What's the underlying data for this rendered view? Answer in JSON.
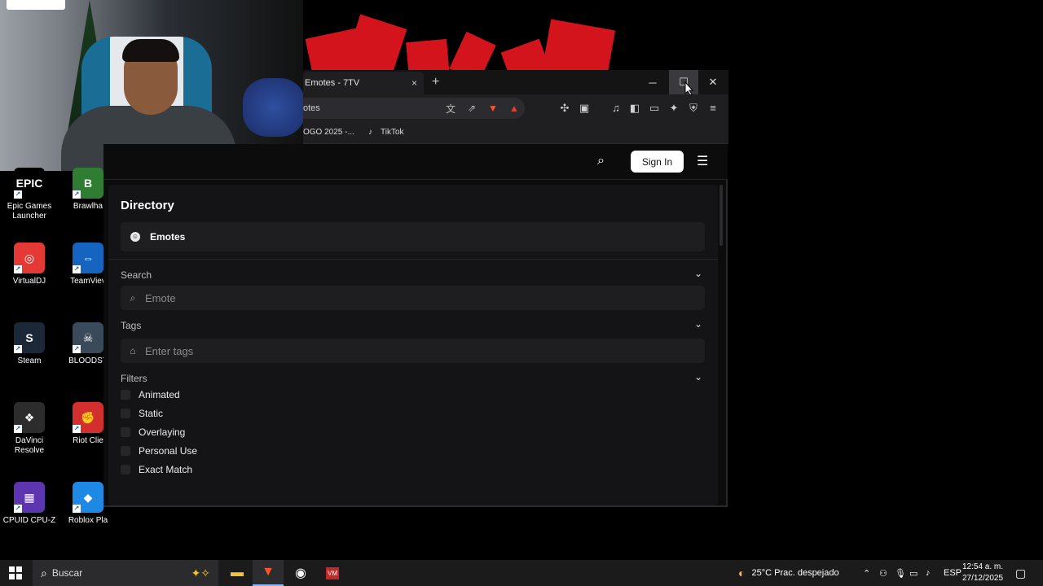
{
  "desktop_icons": [
    {
      "id": "epic",
      "label": "Epic Games Launcher",
      "glyph": "EPIC",
      "color": "#000000"
    },
    {
      "id": "brawl",
      "label": "Brawlha",
      "glyph": "B",
      "color": "#2e7d32"
    },
    {
      "id": "virtualdj",
      "label": "VirtualDJ",
      "glyph": "◎",
      "color": "#e53935"
    },
    {
      "id": "teamviewer",
      "label": "TeamViev",
      "glyph": "⇔",
      "color": "#1565c0"
    },
    {
      "id": "steam",
      "label": "Steam",
      "glyph": "S",
      "color": "#1b2838"
    },
    {
      "id": "bloodstrike",
      "label": "BLOODST",
      "glyph": "☠",
      "color": "#3a4a5a"
    },
    {
      "id": "davinci",
      "label": "DaVinci Resolve",
      "glyph": "❖",
      "color": "#2c2c2c"
    },
    {
      "id": "riot",
      "label": "Riot Clie",
      "glyph": "✊",
      "color": "#d32f2f"
    },
    {
      "id": "cpuz",
      "label": "CPUID CPU-Z",
      "glyph": "▦",
      "color": "#5e35b1"
    },
    {
      "id": "roblox",
      "label": "Roblox Pla",
      "glyph": "◆",
      "color": "#1e88e5"
    }
  ],
  "browser": {
    "tab_title": "Emotes - 7TV",
    "tab_close": "×",
    "new_tab": "+",
    "minimize": "─",
    "maximize": "☐",
    "close": "✕",
    "url": "otes",
    "bookmarks": [
      {
        "label": "OGO 2025 -..."
      },
      {
        "label": "TikTok"
      }
    ]
  },
  "site": {
    "signin_label": "Sign In",
    "directory_title": "Directory",
    "directory_item": "Emotes",
    "search_label": "Search",
    "search_placeholder": "Emote",
    "tags_label": "Tags",
    "tags_placeholder": "Enter tags",
    "filters_label": "Filters",
    "filters": [
      {
        "label": "Animated",
        "checked": false
      },
      {
        "label": "Static",
        "checked": false
      },
      {
        "label": "Overlaying",
        "checked": false
      },
      {
        "label": "Personal Use",
        "checked": false
      },
      {
        "label": "Exact Match",
        "checked": false
      }
    ]
  },
  "taskbar": {
    "search_text": "Buscar",
    "weather": "25°C  Prac. despejado",
    "language": "ESP",
    "time": "12:54 a. m.",
    "date": "27/12/2025"
  },
  "colors": {
    "accent_red": "#d4141c",
    "signin_bg": "#ffffff"
  }
}
